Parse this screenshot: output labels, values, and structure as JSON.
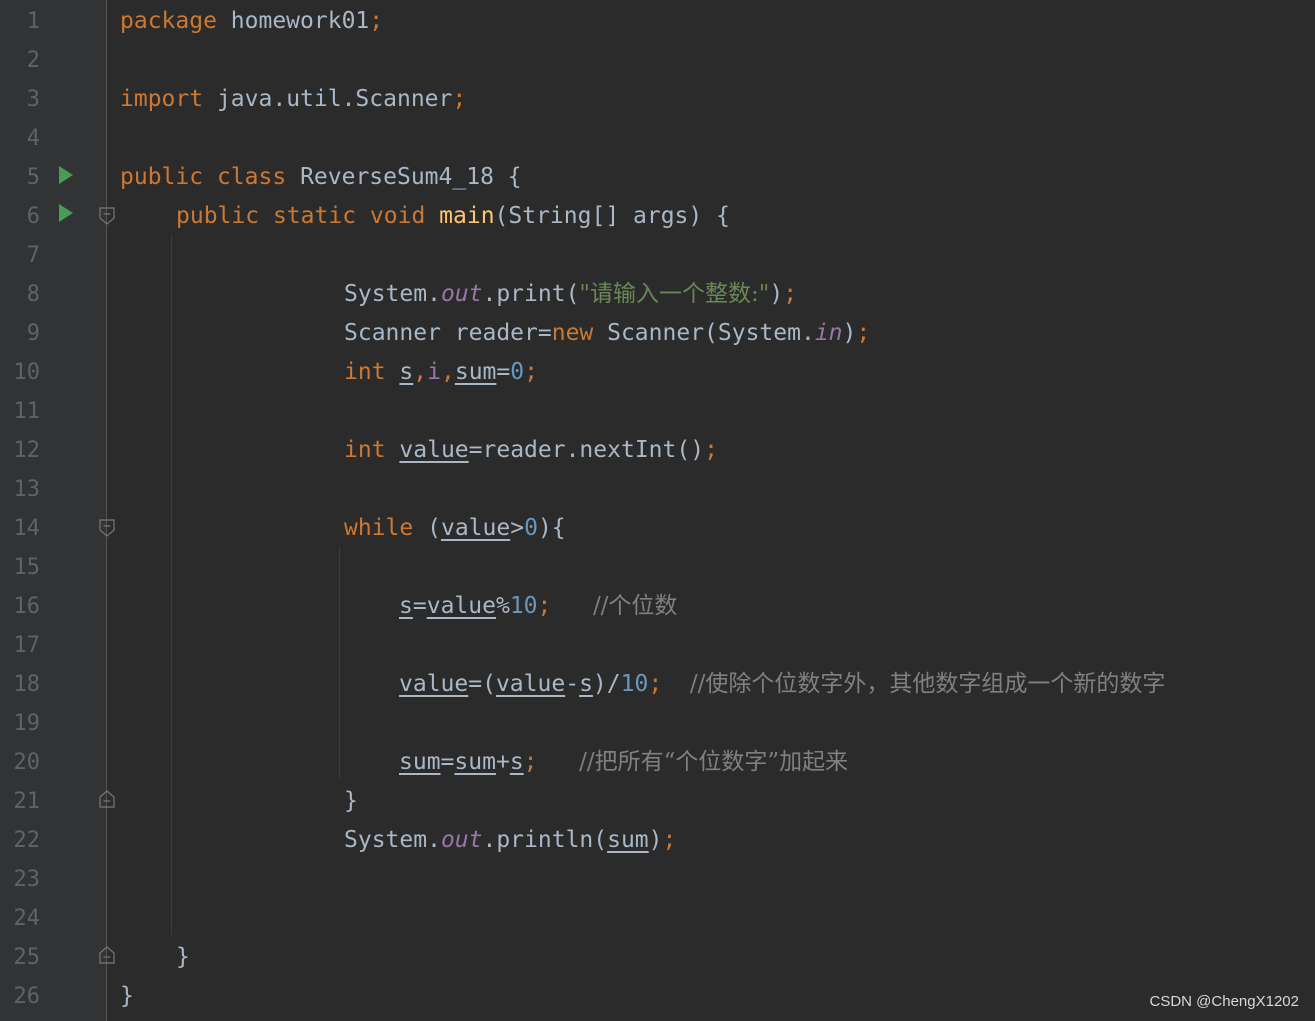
{
  "editor": {
    "line_numbers": [
      "1",
      "2",
      "3",
      "4",
      "5",
      "6",
      "7",
      "8",
      "9",
      "10",
      "11",
      "12",
      "13",
      "14",
      "15",
      "16",
      "17",
      "18",
      "19",
      "20",
      "21",
      "22",
      "23",
      "24",
      "25",
      "26"
    ],
    "gutter_icons": {
      "run": "run-icon",
      "fold": "fold-icon"
    },
    "code": {
      "l1": {
        "kw": "package",
        "name": "homework01",
        "semi": ";"
      },
      "l3": {
        "kw": "import",
        "name": "java.util.Scanner",
        "semi": ";"
      },
      "l5": {
        "kw1": "public",
        "kw2": "class",
        "name": "ReverseSum4_18",
        "brace": "{"
      },
      "l6": {
        "kw1": "public",
        "kw2": "static",
        "kw3": "void",
        "fn": "main",
        "params": "(String[] args) {"
      },
      "l8": {
        "obj": "System.",
        "field": "out",
        "call": ".print(",
        "str": "\"请输入一个整数:\"",
        "close": ")",
        "semi": ";"
      },
      "l9": {
        "type": "Scanner reader=",
        "kw": "new",
        "ctor": " Scanner(System.",
        "field": "in",
        "close": ")",
        "semi": ";"
      },
      "l10": {
        "kw": "int",
        "v1": "s",
        "c1": ",",
        "v2": "i",
        "c2": ",",
        "v3": "sum",
        "eq": "=",
        "num": "0",
        "semi": ";"
      },
      "l12": {
        "kw": "int",
        "v1": "value",
        "rest": "=reader.nextInt()",
        "semi": ";"
      },
      "l14": {
        "kw": "while",
        "open": "(",
        "v1": "value",
        "op": ">",
        "num": "0",
        "close": "){"
      },
      "l16": {
        "v1": "s",
        "eq": "=",
        "v2": "value",
        "op": "%",
        "num": "10",
        "semi": ";",
        "cmt": "//个位数"
      },
      "l18": {
        "v1": "value",
        "eq": "=(",
        "v2": "value",
        "op": "-",
        "v3": "s",
        "close": ")/",
        "num": "10",
        "semi": ";",
        "cmt": "//使除个位数字外，其他数字组成一个新的数字"
      },
      "l20": {
        "v1": "sum",
        "eq": "=",
        "v2": "sum",
        "op": "+",
        "v3": "s",
        "semi": ";",
        "cmt": "//把所有“个位数字”加起来"
      },
      "l21": {
        "brace": "}"
      },
      "l22": {
        "obj": "System.",
        "field": "out",
        "call": ".println(",
        "v1": "sum",
        "close": ")",
        "semi": ";"
      },
      "l25": {
        "brace": "}"
      },
      "l26": {
        "brace": "}"
      }
    }
  },
  "watermark": "CSDN @ChengX1202"
}
